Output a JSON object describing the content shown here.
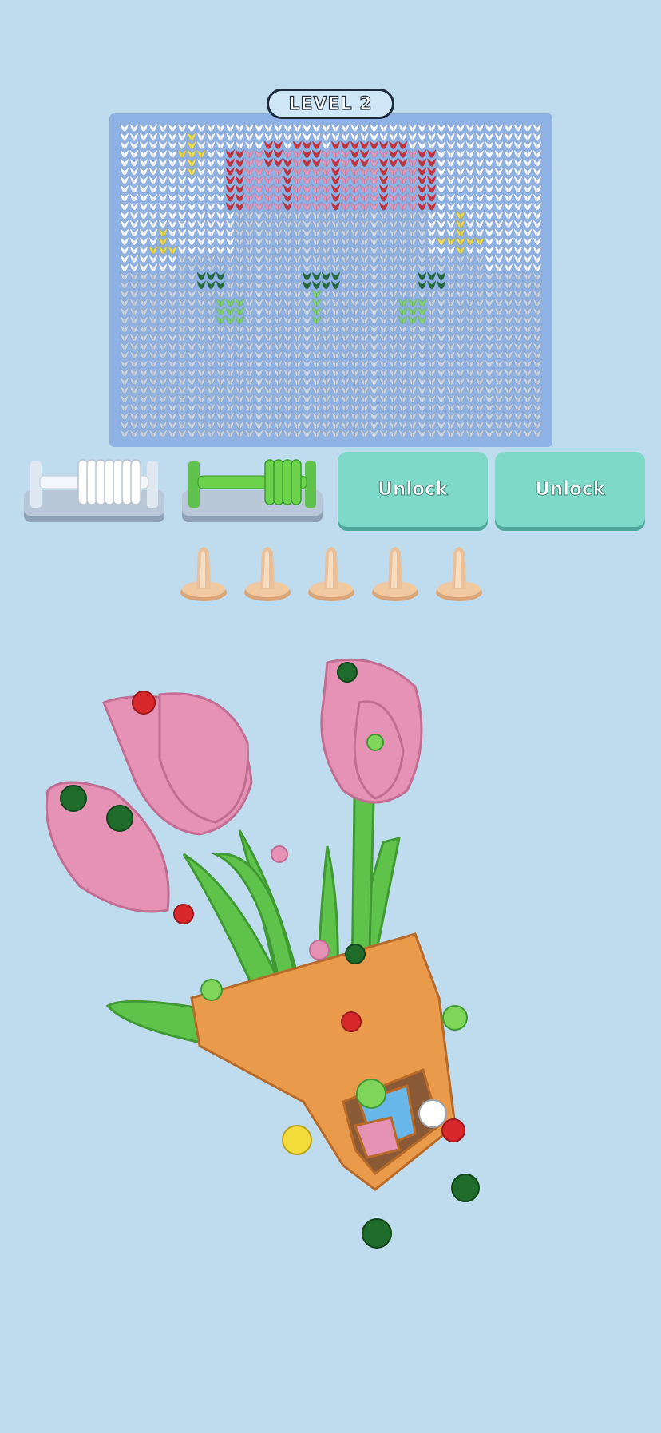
{
  "level": {
    "label": "LEVEL 2"
  },
  "board": {
    "colors": {
      "background": "#ffffff",
      "vase": "#c9d1dc",
      "red": "#d9282b",
      "pink": "#ef8fb0",
      "yellow": "#f4dc3a",
      "dark_green": "#1f6b2b",
      "light_green": "#7fd45a"
    }
  },
  "spools": [
    {
      "color_name": "white",
      "color": "#ffffff",
      "state": "filled"
    },
    {
      "color_name": "green",
      "color": "#6bd24c",
      "state": "filled"
    }
  ],
  "unlock_buttons": [
    {
      "label": "Unlock"
    },
    {
      "label": "Unlock"
    }
  ],
  "pegs": {
    "count": 5,
    "color": "#e8c29a"
  },
  "bouquet": {
    "flower_color": "#e592b5",
    "stem_color": "#5fc24a",
    "pot_color": "#e99a4a",
    "icon": "tulip-bouquet-icon"
  }
}
